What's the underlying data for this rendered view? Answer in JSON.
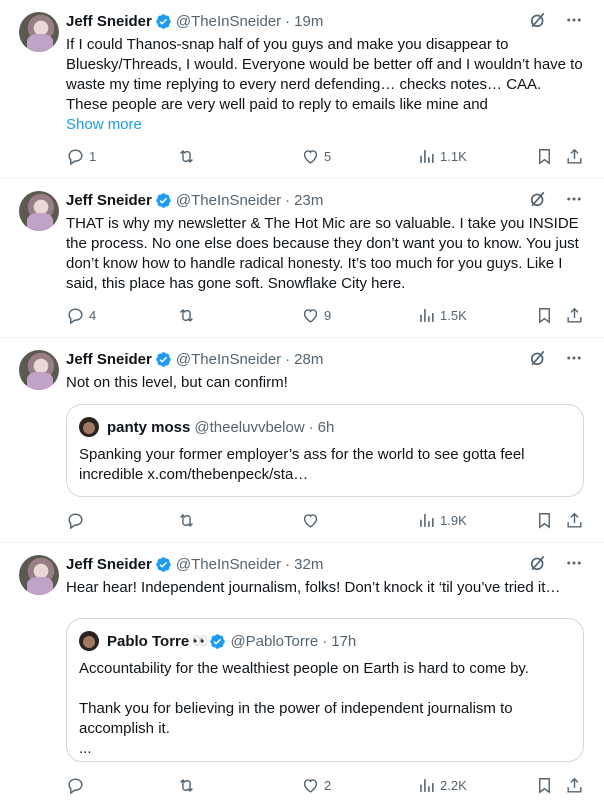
{
  "tweets": [
    {
      "name": "Jeff Sneider",
      "handle": "@TheInSneider",
      "dot": "·",
      "time": "19m",
      "text": "If I could Thanos-snap half of you guys and make you disappear to Bluesky/Threads, I would. Everyone would be better off and I wouldn’t have to waste my time replying to every nerd defending… checks notes… CAA. These people are very well paid to reply to emails like mine and",
      "show_more": "Show more",
      "replies": "1",
      "retweets": "",
      "likes": "5",
      "views": "1.1K"
    },
    {
      "name": "Jeff Sneider",
      "handle": "@TheInSneider",
      "dot": "·",
      "time": "23m",
      "text": "THAT is why my newsletter & The Hot Mic are so valuable. I take you INSIDE the process. No one else does because they don’t want you to know. You just don’t know how to handle radical honesty. It’s too much for you guys. Like I said, this place has gone soft. Snowflake City here.",
      "replies": "4",
      "retweets": "",
      "likes": "9",
      "views": "1.5K"
    },
    {
      "name": "Jeff Sneider",
      "handle": "@TheInSneider",
      "dot": "·",
      "time": "28m",
      "text": "Not on this level, but can confirm!",
      "quote": {
        "name": "panty moss",
        "handle": "@theeluvvbelow",
        "dot": "·",
        "time": "6h",
        "text": "Spanking your former employer’s ass for the world to see gotta feel incredible x.com/thebenpeck/sta…"
      },
      "replies": "",
      "retweets": "",
      "likes": "",
      "views": "1.9K"
    },
    {
      "name": "Jeff Sneider",
      "handle": "@TheInSneider",
      "dot": "·",
      "time": "32m",
      "text": "Hear hear! Independent journalism, folks! Don’t knock it ‘til you’ve tried it…",
      "quote": {
        "name": "Pablo Torre",
        "emoji": "👀",
        "handle": "@PabloTorre",
        "dot": "·",
        "time": "17h",
        "line1": "Accountability for the wealthiest people on Earth is hard to come by.",
        "line2": "Thank you for believing in the power of independent journalism to accomplish it.",
        "line3": "..."
      },
      "replies": "",
      "retweets": "",
      "likes": "2",
      "views": "2.2K"
    }
  ],
  "colors": {
    "accent": "#1d9bf0",
    "muted": "#536471",
    "text": "#0f1419",
    "border": "#cfd9de"
  }
}
